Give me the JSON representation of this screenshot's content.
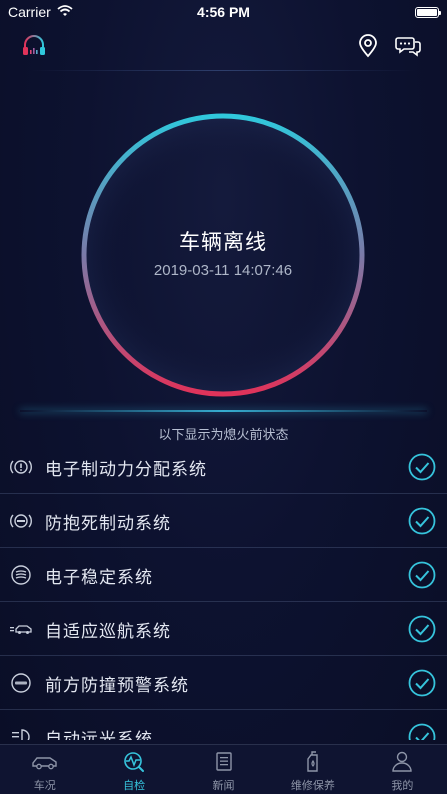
{
  "status_bar": {
    "carrier": "Carrier",
    "time": "4:56 PM",
    "battery_level": 1.0
  },
  "header": {
    "left_icon": "headset-icon",
    "right_icons": [
      "location-pin-icon",
      "chat-bubbles-icon"
    ]
  },
  "vehicle": {
    "status": "车辆离线",
    "timestamp": "2019-03-11 14:07:46"
  },
  "ring_colors": {
    "top": "#30c8dc",
    "middle": "#7a7aa8",
    "bottom": "#e0335a"
  },
  "section_caption": "以下显示为熄火前状态",
  "checks": [
    {
      "label": "电子制动力分配系统",
      "icon": "warning-circle-icon",
      "status": "ok"
    },
    {
      "label": "防抱死制动系统",
      "icon": "abs-icon",
      "status": "ok"
    },
    {
      "label": "电子稳定系统",
      "icon": "stability-icon",
      "status": "ok"
    },
    {
      "label": "自适应巡航系统",
      "icon": "cruise-car-icon",
      "status": "ok"
    },
    {
      "label": "前方防撞预警系统",
      "icon": "fcm-icon",
      "status": "ok"
    },
    {
      "label": "自动远光系统",
      "icon": "high-beam-icon",
      "status": "ok"
    }
  ],
  "accent_color": "#36c4dc",
  "tabs": [
    {
      "label": "车况",
      "icon": "car-icon",
      "active": false
    },
    {
      "label": "自检",
      "icon": "diagnostics-icon",
      "active": true
    },
    {
      "label": "新闻",
      "icon": "news-icon",
      "active": false
    },
    {
      "label": "维修保养",
      "icon": "maintenance-icon",
      "active": false
    },
    {
      "label": "我的",
      "icon": "profile-icon",
      "active": false
    }
  ]
}
